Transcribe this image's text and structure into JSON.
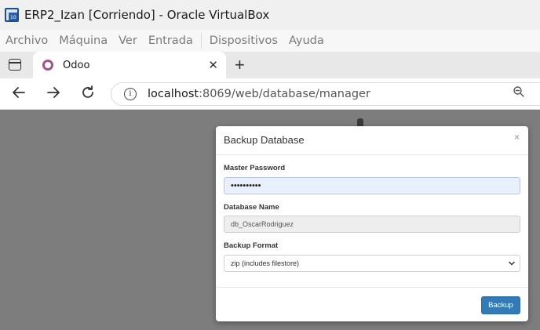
{
  "window": {
    "title": "ERP2_Izan [Corriendo] - Oracle VirtualBox",
    "icon": "virtualbox-icon"
  },
  "vbox_menu": {
    "items": [
      "Archivo",
      "Máquina",
      "Ver",
      "Entrada",
      "Dispositivos",
      "Ayuda"
    ]
  },
  "browser": {
    "tab_title": "Odoo",
    "tab_close": "✕",
    "new_tab": "+",
    "url_host": "localhost",
    "url_path": ":8069/web/database/manager"
  },
  "modal": {
    "title": "Backup Database",
    "close": "×",
    "master_password_label": "Master Password",
    "master_password_value": "••••••••••",
    "database_name_label": "Database Name",
    "database_name_value": "db_OscarRodriguez",
    "backup_format_label": "Backup Format",
    "backup_format_value": "zip (includes filestore)",
    "backup_button": "Backup"
  },
  "colors": {
    "primary_button": "#337ab7",
    "backdrop": "#7d7d7d",
    "favicon": "#a0558a"
  }
}
